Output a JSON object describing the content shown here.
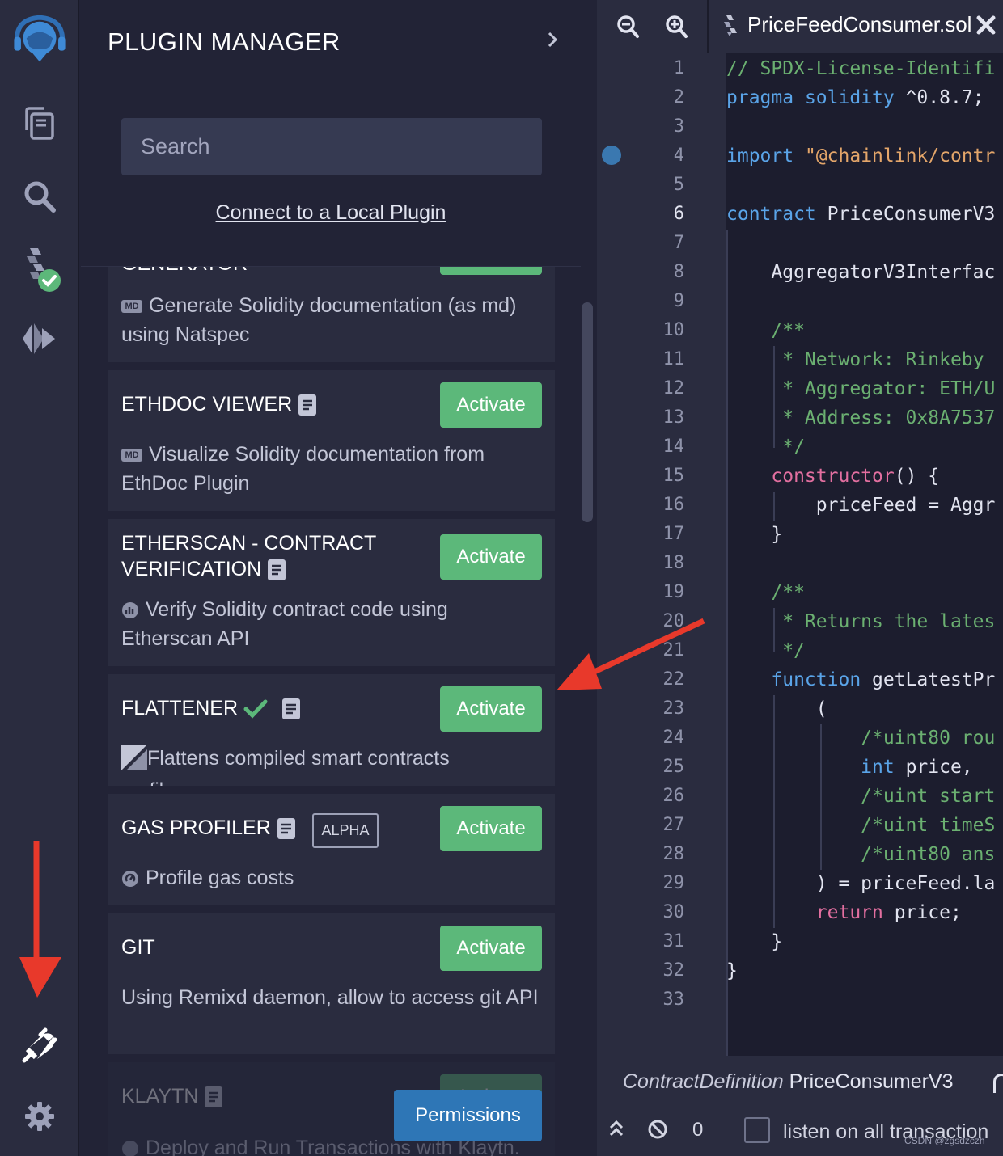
{
  "panel": {
    "title": "PLUGIN MANAGER",
    "search_placeholder": "Search",
    "connect_link": "Connect to a Local Plugin",
    "activate_label": "Activate",
    "permissions_label": "Permissions"
  },
  "plugins": [
    {
      "name": "GENERATOR",
      "desc": "Generate Solidity documentation (as md) using Natspec"
    },
    {
      "name": "ETHDOC VIEWER",
      "desc": "Visualize Solidity documentation from EthDoc Plugin"
    },
    {
      "name_line1": "ETHERSCAN - CONTRACT",
      "name_line2": "VERIFICATION",
      "desc": "Verify Solidity contract code using Etherscan API"
    },
    {
      "name": "FLATTENER",
      "desc": "Flattens compiled smart contracts",
      "desc_extra": "profile"
    },
    {
      "name": "GAS PROFILER",
      "badge": "ALPHA",
      "desc": "Profile gas costs"
    },
    {
      "name": "GIT",
      "desc": "Using Remixd daemon, allow to access git API"
    },
    {
      "name": "KLAYTN",
      "desc": "Deploy and Run Transactions with Klaytn."
    }
  ],
  "editor": {
    "tab_title": "PriceFeedConsumer.sol",
    "lines": [
      "// SPDX-License-Identifi",
      "pragma solidity ^0.8.7;",
      "",
      "import \"@chainlink/contr",
      "",
      "contract PriceConsumerV3",
      "",
      "    AggregatorV3Interfac",
      "",
      "    /**",
      "     * Network: Rinkeby",
      "     * Aggregator: ETH/U",
      "     * Address: 0x8A7537",
      "     */",
      "    constructor() {",
      "        priceFeed = Aggr",
      "    }",
      "",
      "    /**",
      "     * Returns the lates",
      "     */",
      "    function getLatestPr",
      "        (",
      "            /*uint80 rou",
      "            int price,",
      "            /*uint start",
      "            /*uint timeS",
      "            /*uint80 ans",
      "        ) = priceFeed.la",
      "        return price;",
      "    }",
      "}",
      ""
    ],
    "line_numbers": [
      "1",
      "2",
      "3",
      "4",
      "5",
      "6",
      "7",
      "8",
      "9",
      "10",
      "11",
      "12",
      "13",
      "14",
      "15",
      "16",
      "17",
      "18",
      "19",
      "20",
      "21",
      "22",
      "23",
      "24",
      "25",
      "26",
      "27",
      "28",
      "29",
      "30",
      "31",
      "32",
      "33"
    ],
    "status_kind": "ContractDefinition",
    "status_name": "PriceConsumerV3",
    "terminal_count": "0",
    "listen_label": "listen on all transaction"
  },
  "watermark": "CSDN @zgsdzczh",
  "colors": {
    "accent_green": "#5cb87a",
    "permissions_blue": "#2e76b6",
    "arrow_red": "#e8392b",
    "panel_bg": "#222336",
    "card_bg": "#2a2c3f"
  },
  "icons": {
    "rail": [
      "remix-logo-icon",
      "file-explorer-icon",
      "search-icon",
      "solidity-compiler-icon",
      "deploy-run-icon",
      "plugin-icon",
      "settings-icon"
    ],
    "editor": [
      "zoom-out-icon",
      "zoom-in-icon",
      "solidity-file-icon",
      "close-icon"
    ]
  }
}
